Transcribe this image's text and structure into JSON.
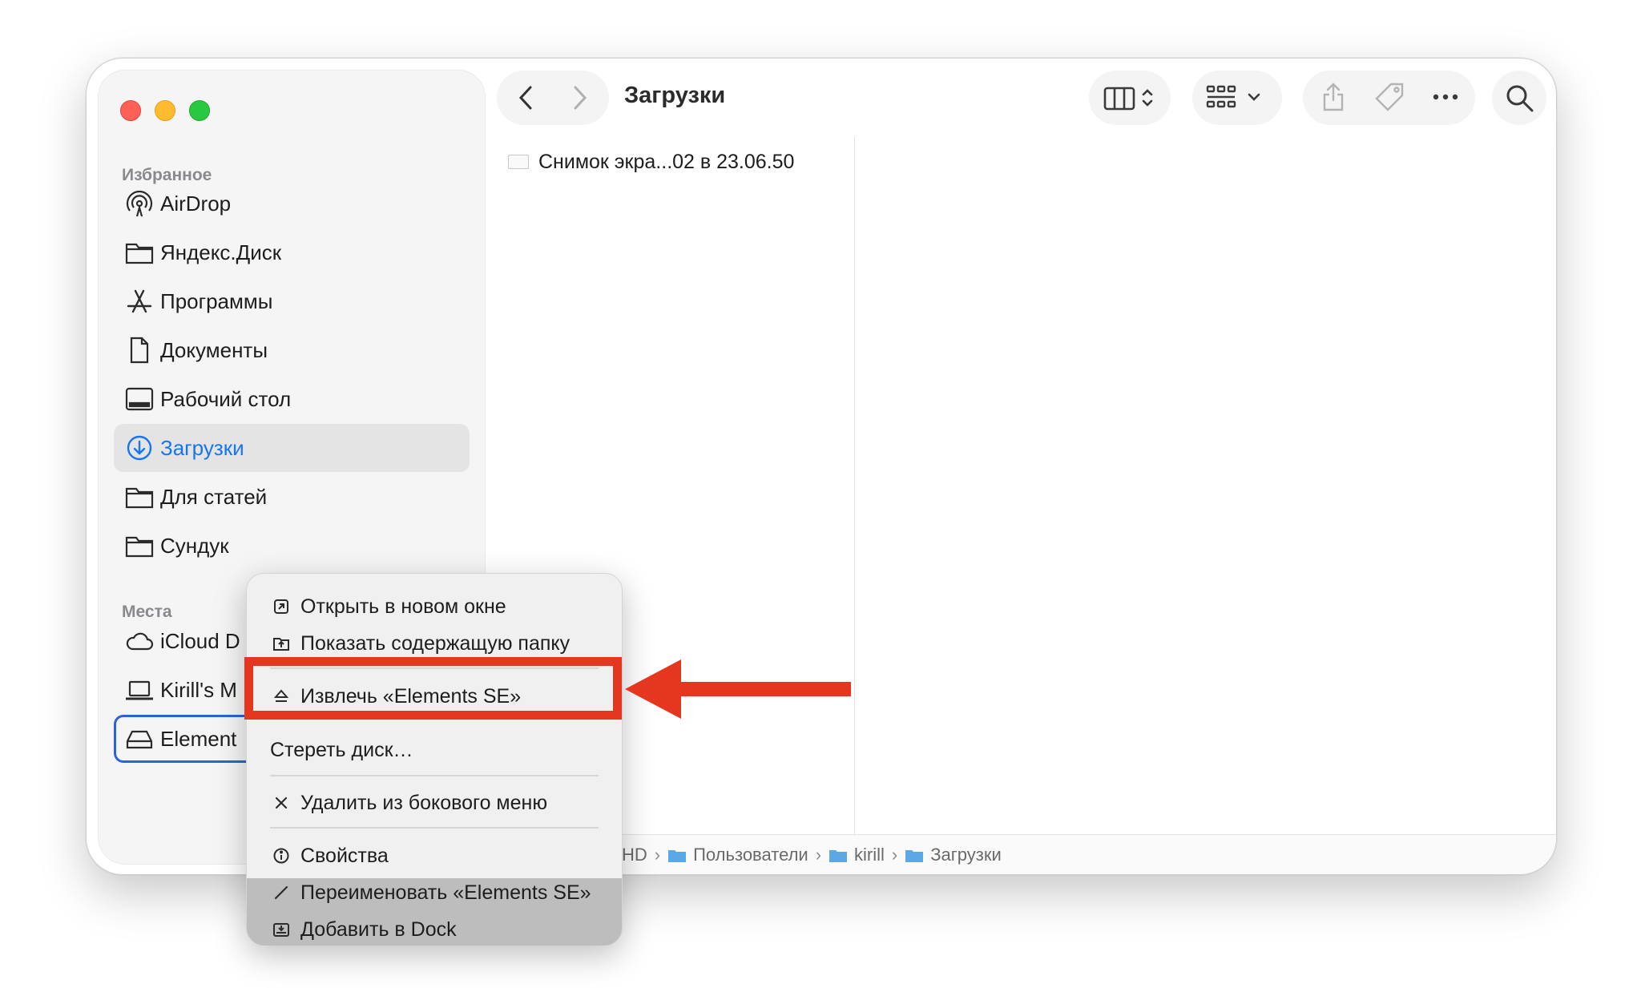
{
  "window": {
    "title": "Загрузки"
  },
  "sidebar": {
    "favorites_title": "Избранное",
    "favorites": [
      {
        "label": "AirDrop",
        "icon": "airdrop-icon"
      },
      {
        "label": "Яндекс.Диск",
        "icon": "folder-icon"
      },
      {
        "label": "Программы",
        "icon": "applications-icon"
      },
      {
        "label": "Документы",
        "icon": "document-icon"
      },
      {
        "label": "Рабочий стол",
        "icon": "desktop-icon"
      },
      {
        "label": "Загрузки",
        "icon": "downloads-icon",
        "selected": true
      },
      {
        "label": "Для статей",
        "icon": "folder-icon"
      },
      {
        "label": "Сундук",
        "icon": "folder-icon"
      }
    ],
    "places_title": "Места",
    "places": [
      {
        "label": "iCloud D",
        "icon": "cloud-icon"
      },
      {
        "label": "Kirill's M",
        "icon": "laptop-icon"
      },
      {
        "label": "Element",
        "icon": "drive-icon"
      }
    ]
  },
  "content": {
    "files": [
      {
        "name": "Снимок экра...02 в 23.06.50"
      }
    ]
  },
  "pathbar": {
    "crumbs": [
      "HD",
      "Пользователи",
      "kirill",
      "Загрузки"
    ]
  },
  "context_menu": {
    "items": [
      {
        "label": "Открыть в новом окне",
        "icon": "open-new-window-icon"
      },
      {
        "label": "Показать содержащую папку",
        "icon": "show-enclosing-folder-icon"
      },
      {
        "label": "Извлечь «Elements SE»",
        "icon": "eject-icon",
        "highlighted": true
      },
      {
        "label": "Стереть диск…",
        "icon": ""
      },
      {
        "label": "Удалить из бокового меню",
        "icon": "remove-icon"
      },
      {
        "label": "Свойства",
        "icon": "info-icon"
      },
      {
        "label": "Переименовать «Elements SE»",
        "icon": "rename-icon"
      },
      {
        "label": "Добавить в Dock",
        "icon": "dock-icon"
      }
    ]
  },
  "annotation": {
    "color": "#e5361f"
  },
  "colors": {
    "accent": "#1675f2",
    "selection_bg": "#e4e4e4"
  }
}
